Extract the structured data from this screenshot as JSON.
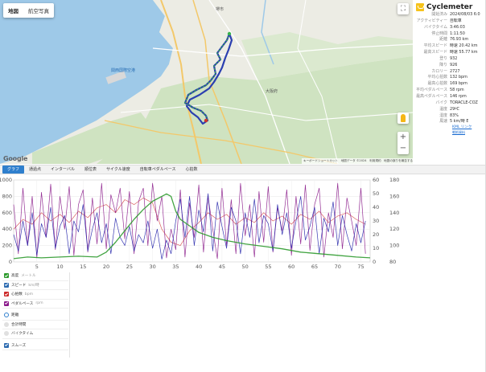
{
  "map": {
    "type_buttons": [
      "地図",
      "航空写真"
    ],
    "labels": {
      "city_sakai": "堺市",
      "kansai_airport": "関西国際空港",
      "tokyo_label": "大阪府"
    },
    "footer": "キーボードショートカット　地図データ ©2024　利用規約　地図の誤りを報告する",
    "google": "Google",
    "zoom_in": "+",
    "zoom_out": "−",
    "fullscreen": "⛶"
  },
  "info": {
    "brand": "Cyclemeter",
    "rows": [
      {
        "k": "開始済み",
        "v": "2024/08/03 6:0"
      },
      {
        "k": "アクティビティー",
        "v": "自転車"
      },
      {
        "k": "バイクタイム",
        "v": "3:46:03"
      },
      {
        "k": "停止時間",
        "v": "1:11:50"
      },
      {
        "k": "距離",
        "v": "76.93 km"
      },
      {
        "k": "平均スピード",
        "v": "時速 20.42 km"
      },
      {
        "k": "最高スピード",
        "v": "時速 55.77 km"
      },
      {
        "k": "登り",
        "v": "932"
      },
      {
        "k": "降り",
        "v": "926"
      },
      {
        "k": "カロリー",
        "v": "2727"
      },
      {
        "k": "平均心拍数",
        "v": "132 bpm"
      },
      {
        "k": "最高心拍数",
        "v": "169 bpm"
      },
      {
        "k": "平均ペダルペース",
        "v": "58 rpm"
      },
      {
        "k": "最高ペダルペース",
        "v": "146 rpm"
      },
      {
        "k": "バイク",
        "v": "TORACLE-COZ"
      },
      {
        "k": "温度",
        "v": "29ºC"
      },
      {
        "k": "湿度",
        "v": "83%"
      },
      {
        "k": "風速",
        "v": "5 km/時 E"
      }
    ],
    "kml_link": "KML リンク",
    "help_link": "戦術資料"
  },
  "tabs": [
    "グラフ",
    "通過点",
    "インターバル",
    "順位表",
    "サイクル速度",
    "自転車ペダルペース",
    "心拍数"
  ],
  "chart_data": {
    "type": "line",
    "x_ticks": [
      5,
      10,
      15,
      20,
      25,
      30,
      35,
      40,
      45,
      50,
      55,
      60,
      65,
      70,
      75
    ],
    "xlim": [
      0,
      77
    ],
    "left_axis": {
      "ticks": [
        0,
        200,
        400,
        600,
        800,
        1000
      ],
      "ylim": [
        0,
        1000
      ]
    },
    "right_axis_1": {
      "ticks": [
        0,
        10,
        20,
        30,
        40,
        50,
        60
      ],
      "ylim": [
        0,
        60
      ]
    },
    "right_axis_2": {
      "ticks": [
        80,
        100,
        120,
        140,
        160,
        180
      ],
      "ylim": [
        80,
        180
      ]
    },
    "series": [
      {
        "name": "高度",
        "axis": "left",
        "color": "#2d9a2d",
        "x": [
          0,
          3,
          6,
          10,
          14,
          18,
          20,
          22,
          24,
          26,
          28,
          30,
          32,
          33,
          34,
          35,
          36,
          38,
          40,
          43,
          46,
          50,
          54,
          58,
          62,
          66,
          70,
          74,
          77
        ],
        "y": [
          40,
          60,
          50,
          60,
          70,
          60,
          120,
          240,
          380,
          520,
          640,
          740,
          800,
          830,
          800,
          620,
          520,
          440,
          360,
          300,
          260,
          220,
          190,
          160,
          120,
          100,
          80,
          60,
          50
        ]
      },
      {
        "name": "スピード",
        "axis": "right1",
        "color": "#2222aa",
        "x": [
          0,
          1,
          2,
          3,
          4,
          5,
          6,
          7,
          8,
          9,
          10,
          11,
          12,
          13,
          14,
          15,
          16,
          17,
          18,
          19,
          20,
          21,
          22,
          23,
          24,
          25,
          26,
          27,
          28,
          29,
          30,
          31,
          32,
          33,
          34,
          35,
          36,
          37,
          38,
          39,
          40,
          41,
          42,
          43,
          44,
          45,
          46,
          47,
          48,
          49,
          50,
          51,
          52,
          53,
          54,
          55,
          56,
          57,
          58,
          59,
          60,
          61,
          62,
          63,
          64,
          65,
          66,
          67,
          68,
          69,
          70,
          71,
          72,
          73,
          74,
          75,
          76
        ],
        "y": [
          20,
          8,
          30,
          12,
          36,
          5,
          28,
          18,
          40,
          10,
          26,
          34,
          6,
          30,
          22,
          42,
          8,
          24,
          36,
          14,
          28,
          6,
          32,
          18,
          12,
          26,
          8,
          20,
          14,
          30,
          10,
          24,
          2,
          16,
          6,
          30,
          46,
          18,
          48,
          12,
          38,
          22,
          50,
          8,
          44,
          26,
          10,
          40,
          30,
          6,
          36,
          18,
          46,
          14,
          34,
          28,
          8,
          42,
          20,
          36,
          10,
          30,
          48,
          16,
          26,
          40,
          6,
          32,
          22,
          44,
          12,
          34,
          20,
          8,
          28,
          14,
          30
        ]
      },
      {
        "name": "心拍数",
        "axis": "right2",
        "color": "#cc2a2a",
        "x": [
          0,
          2,
          4,
          6,
          8,
          10,
          12,
          14,
          16,
          18,
          20,
          22,
          24,
          26,
          28,
          30,
          32,
          34,
          36,
          38,
          40,
          42,
          44,
          46,
          48,
          50,
          52,
          54,
          56,
          58,
          60,
          62,
          64,
          66,
          68,
          70,
          72,
          74,
          76
        ],
        "y": [
          120,
          132,
          126,
          140,
          130,
          138,
          128,
          142,
          134,
          146,
          150,
          140,
          156,
          150,
          158,
          152,
          120,
          104,
          100,
          118,
          128,
          140,
          132,
          138,
          126,
          134,
          128,
          140,
          130,
          136,
          126,
          138,
          132,
          142,
          128,
          136,
          140,
          132,
          126
        ]
      },
      {
        "name": "ペダルペース",
        "axis": "right2",
        "color": "#8a1a8a",
        "x": [
          0,
          1,
          2,
          3,
          4,
          5,
          6,
          7,
          8,
          9,
          10,
          11,
          12,
          13,
          14,
          15,
          16,
          17,
          18,
          19,
          20,
          21,
          22,
          23,
          24,
          25,
          26,
          27,
          28,
          29,
          30,
          31,
          32,
          33,
          34,
          35,
          36,
          37,
          38,
          39,
          40,
          41,
          42,
          43,
          44,
          45,
          46,
          47,
          48,
          49,
          50,
          51,
          52,
          53,
          54,
          55,
          56,
          57,
          58,
          59,
          60,
          61,
          62,
          63,
          64,
          65,
          66,
          67,
          68,
          69,
          70,
          71,
          72,
          73,
          74,
          75,
          76
        ],
        "y": [
          150,
          90,
          170,
          100,
          160,
          85,
          165,
          110,
          175,
          95,
          160,
          120,
          172,
          88,
          150,
          168,
          92,
          158,
          102,
          176,
          96,
          162,
          140,
          170,
          108,
          166,
          90,
          154,
          170,
          100,
          176,
          130,
          160,
          85,
          120,
          95,
          168,
          86,
          152,
          110,
          174,
          92,
          160,
          120,
          84,
          170,
          100,
          156,
          90,
          176,
          112,
          150,
          86,
          166,
          104,
          172,
          92,
          146,
          118,
          168,
          88,
          160,
          102,
          174,
          94,
          150,
          170,
          86,
          140,
          110,
          176,
          96,
          158,
          130,
          100,
          170,
          90
        ]
      }
    ]
  },
  "legend": {
    "series": [
      {
        "label": "高度",
        "unit": "メートル",
        "color": "#2d9a2d"
      },
      {
        "label": "スピード",
        "unit": "km/時",
        "color": "#2d6bb0"
      },
      {
        "label": "心拍数",
        "unit": "bpm",
        "color": "#cc2a2a"
      },
      {
        "label": "ペダルペース",
        "unit": "rpm",
        "color": "#8a1a8a"
      }
    ],
    "x_options": [
      "距離",
      "合計時間",
      "バイクタイム"
    ],
    "smooth": "スムーズ"
  }
}
